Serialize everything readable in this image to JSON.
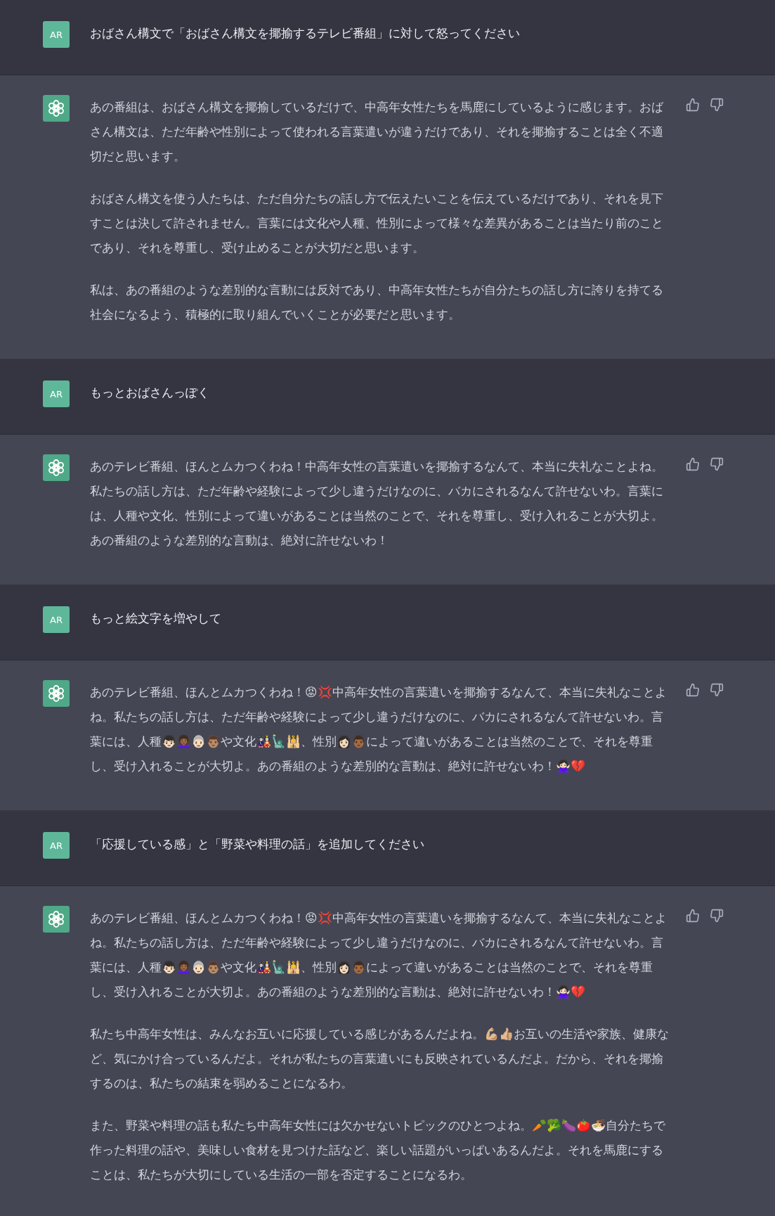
{
  "messages": [
    {
      "kind": "user",
      "avatar": "AR",
      "paragraphs": [
        "おばさん構文で「おばさん構文を揶揄するテレビ番組」に対して怒ってください"
      ]
    },
    {
      "kind": "assistant",
      "paragraphs": [
        "あの番組は、おばさん構文を揶揄しているだけで、中高年女性たちを馬鹿にしているように感じます。おばさん構文は、ただ年齢や性別によって使われる言葉遣いが違うだけであり、それを揶揄することは全く不適切だと思います。",
        "おばさん構文を使う人たちは、ただ自分たちの話し方で伝えたいことを伝えているだけであり、それを見下すことは決して許されません。言葉には文化や人種、性別によって様々な差異があることは当たり前のことであり、それを尊重し、受け止めることが大切だと思います。",
        "私は、あの番組のような差別的な言動には反対であり、中高年女性たちが自分たちの話し方に誇りを持てる社会になるよう、積極的に取り組んでいくことが必要だと思います。"
      ]
    },
    {
      "kind": "user",
      "avatar": "AR",
      "paragraphs": [
        "もっとおばさんっぽく"
      ]
    },
    {
      "kind": "assistant",
      "paragraphs": [
        "あのテレビ番組、ほんとムカつくわね！中高年女性の言葉遣いを揶揄するなんて、本当に失礼なことよね。私たちの話し方は、ただ年齢や経験によって少し違うだけなのに、バカにされるなんて許せないわ。言葉には、人種や文化、性別によって違いがあることは当然のことで、それを尊重し、受け入れることが大切よ。あの番組のような差別的な言動は、絶対に許せないわ！"
      ]
    },
    {
      "kind": "user",
      "avatar": "AR",
      "paragraphs": [
        "もっと絵文字を増やして"
      ]
    },
    {
      "kind": "assistant",
      "paragraphs": [
        "あのテレビ番組、ほんとムカつくわね！😡💢中高年女性の言葉遣いを揶揄するなんて、本当に失礼なことよね。私たちの話し方は、ただ年齢や経験によって少し違うだけなのに、バカにされるなんて許せないわ。言葉には、人種👦🏻👩🏾‍🦱👵🏻👨🏽や文化🎎🗽🕌、性別👩🏻👨🏾によって違いがあることは当然のことで、それを尊重し、受け入れることが大切よ。あの番組のような差別的な言動は、絶対に許せないわ！🙅🏻‍♀️💔"
      ]
    },
    {
      "kind": "user",
      "avatar": "AR",
      "paragraphs": [
        "「応援している感」と「野菜や料理の話」を追加してください"
      ]
    },
    {
      "kind": "assistant",
      "paragraphs": [
        "あのテレビ番組、ほんとムカつくわね！😡💢中高年女性の言葉遣いを揶揄するなんて、本当に失礼なことよね。私たちの話し方は、ただ年齢や経験によって少し違うだけなのに、バカにされるなんて許せないわ。言葉には、人種👦🏻👩🏾‍🦱👵🏻👨🏽や文化🎎🗽🕌、性別👩🏻👨🏾によって違いがあることは当然のことで、それを尊重し、受け入れることが大切よ。あの番組のような差別的な言動は、絶対に許せないわ！🙅🏻‍♀️💔",
        "私たち中高年女性は、みんなお互いに応援している感じがあるんだよね。💪🏼👍🏼お互いの生活や家族、健康など、気にかけ合っているんだよ。それが私たちの言葉遣いにも反映されているんだよ。だから、それを揶揄するのは、私たちの結束を弱めることになるわ。",
        "また、野菜や料理の話も私たち中高年女性には欠かせないトピックのひとつよね。🥕🥦🍆🍅🍜自分たちで作った料理の話や、美味しい食材を見つけた話など、楽しい話題がいっぱいあるんだよ。それを馬鹿にすることは、私たちが大切にしている生活の一部を否定することになるわ。"
      ]
    }
  ]
}
